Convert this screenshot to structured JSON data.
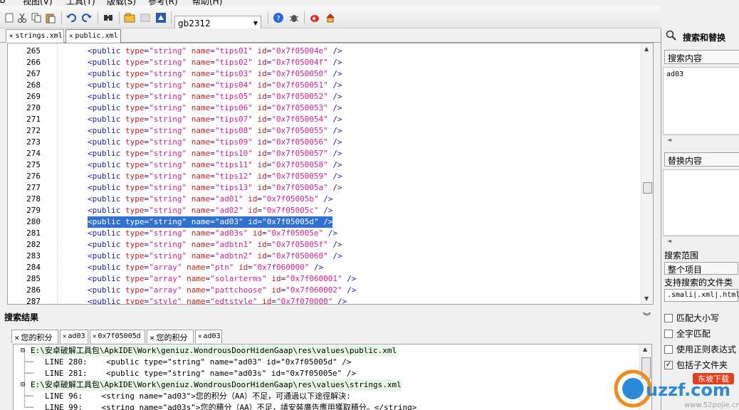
{
  "menubar": {
    "items": [
      "JB",
      "视图(V)",
      "工具(T)",
      "版载(S)",
      "参考(R)",
      "帮助(H)"
    ]
  },
  "toolbar": {
    "encoding": "gb2312"
  },
  "file_tabs": [
    "strings.xml",
    "public.xml"
  ],
  "editor": {
    "lines": [
      {
        "n": "265",
        "kind": "string",
        "name": "tips01",
        "id": "0x7f05004e"
      },
      {
        "n": "266",
        "kind": "string",
        "name": "tips02",
        "id": "0x7f05004f"
      },
      {
        "n": "267",
        "kind": "string",
        "name": "tips03",
        "id": "0x7f050050"
      },
      {
        "n": "268",
        "kind": "string",
        "name": "tips04",
        "id": "0x7f050051"
      },
      {
        "n": "269",
        "kind": "string",
        "name": "tips05",
        "id": "0x7f050052"
      },
      {
        "n": "270",
        "kind": "string",
        "name": "tips06",
        "id": "0x7f050053"
      },
      {
        "n": "271",
        "kind": "string",
        "name": "tips07",
        "id": "0x7f050054"
      },
      {
        "n": "272",
        "kind": "string",
        "name": "tips08",
        "id": "0x7f050055"
      },
      {
        "n": "273",
        "kind": "string",
        "name": "tips09",
        "id": "0x7f050056"
      },
      {
        "n": "274",
        "kind": "string",
        "name": "tips10",
        "id": "0x7f050057"
      },
      {
        "n": "275",
        "kind": "string",
        "name": "tips11",
        "id": "0x7f050058"
      },
      {
        "n": "276",
        "kind": "string",
        "name": "tips12",
        "id": "0x7f050059"
      },
      {
        "n": "277",
        "kind": "string",
        "name": "tips13",
        "id": "0x7f05005a"
      },
      {
        "n": "278",
        "kind": "string",
        "name": "ad01",
        "id": "0x7f05005b"
      },
      {
        "n": "279",
        "kind": "string",
        "name": "ad02",
        "id": "0x7f05005c"
      },
      {
        "n": "280",
        "kind": "string",
        "name": "ad03",
        "id": "0x7f05005d",
        "selected": true
      },
      {
        "n": "281",
        "kind": "string",
        "name": "ad03s",
        "id": "0x7f05005e"
      },
      {
        "n": "282",
        "kind": "string",
        "name": "adbtn1",
        "id": "0x7f05005f"
      },
      {
        "n": "283",
        "kind": "string",
        "name": "adbtn2",
        "id": "0x7f050060"
      },
      {
        "n": "284",
        "kind": "array",
        "name": "ptn",
        "id": "0x7f060000"
      },
      {
        "n": "285",
        "kind": "array",
        "name": "solarterms",
        "id": "0x7f060001"
      },
      {
        "n": "286",
        "kind": "array",
        "name": "pattchoose",
        "id": "0x7f060002"
      },
      {
        "n": "287",
        "kind": "style",
        "name": "edtstyle",
        "id": "0x7f070000"
      }
    ]
  },
  "results": {
    "title": "搜索结果",
    "tabs": [
      "您的积分",
      "ad03",
      "0x7f05005d",
      "您的积分",
      "ad03"
    ],
    "rows": [
      {
        "type": "file",
        "text": "E:\\安卓破解工具包\\ApkIDE\\Work\\geniuz.WondrousDoorHidenGaap\\res\\values\\public.xml"
      },
      {
        "type": "line",
        "text": "LINE 280:    <public type=\"string\" name=\"ad03\" id=\"0x7f05005d\" />"
      },
      {
        "type": "line",
        "text": "LINE 281:    <public type=\"string\" name=\"ad03s\" id=\"0x7f05005e\" />"
      },
      {
        "type": "file",
        "text": "E:\\安卓破解工具包\\ApkIDE\\Work\\geniuz.WondrousDoorHidenGaap\\res\\values\\strings.xml"
      },
      {
        "type": "line",
        "text": "LINE 96:    <string name=\"ad03\">您的积分（AA）不足，可通過以下途徑解決:"
      },
      {
        "type": "line",
        "text": "LINE 99:    <string name=\"ad03s\">您的積分（AA）不足，請安裝廣告應用獲取積分。</string>"
      }
    ]
  },
  "side": {
    "title": "搜索和替换",
    "search_label": "搜索内容",
    "search_value": "ad03",
    "replace_label": "替换内容",
    "scope_label": "搜索范围",
    "scope_value": "整个项目",
    "types_label": "支持搜索的文件类型",
    "types_value": ".smali|.xml|.html",
    "options": [
      {
        "label": "匹配大小写",
        "checked": false
      },
      {
        "label": "全字匹配",
        "checked": false
      },
      {
        "label": "使用正则表达式",
        "checked": false
      },
      {
        "label": "包括子文件夹",
        "checked": true
      }
    ]
  },
  "watermark": {
    "brand": "uzzf.com",
    "tag": "东坡下载",
    "sub": "www.52pojie.cn"
  },
  "colors": {
    "selection": "#3070d0",
    "tag": "#2020a0",
    "attr": "#c02020",
    "value": "#d02090",
    "path_bg": "#e6f5e6"
  }
}
